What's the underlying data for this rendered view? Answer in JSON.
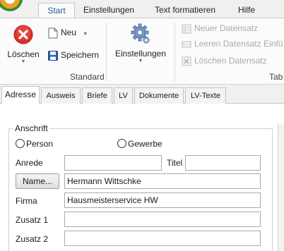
{
  "ribbon": {
    "tabs": [
      {
        "label": "Start",
        "active": true
      },
      {
        "label": "Einstellungen",
        "active": false
      },
      {
        "label": "Text formatieren",
        "active": false
      },
      {
        "label": "Hilfe",
        "active": false
      }
    ],
    "standard_group": {
      "label": "Standard",
      "delete_label": "Löschen",
      "new_label": "Neu",
      "save_label": "Speichern",
      "settings_label": "Einstellungen"
    },
    "tab_group": {
      "label": "Tab",
      "new_record": "Neuer Datensatz",
      "insert_empty_record": "Leeren Datensatz Einfü",
      "delete_record": "Löschen Datensatz"
    }
  },
  "doc_tabs": [
    {
      "label": "Adresse",
      "active": true
    },
    {
      "label": "Ausweis",
      "active": false
    },
    {
      "label": "Briefe",
      "active": false
    },
    {
      "label": "LV",
      "active": false
    },
    {
      "label": "Dokumente",
      "active": false
    },
    {
      "label": "LV-Texte",
      "active": false
    }
  ],
  "form": {
    "section_title": "Anschrift",
    "type_options": {
      "person": "Person",
      "business": "Gewerbe"
    },
    "anrede_label": "Anrede",
    "anrede_value": "",
    "titel_label": "Titel",
    "titel_value": "",
    "name_button": "Name...",
    "name_value": "Hermann Wittschke",
    "firma_label": "Firma",
    "firma_value": "Hausmeisterservice HW",
    "zusatz1_label": "Zusatz 1",
    "zusatz1_value": "",
    "zusatz2_label": "Zusatz 2",
    "zusatz2_value": ""
  },
  "colors": {
    "accent": "#2b579a",
    "delete_red": "#d9312b",
    "ribbon_bg": "#fbfbfb",
    "disabled_text": "#a9a9a9"
  },
  "icons": [
    "app-orb-icon",
    "delete-icon",
    "new-document-icon",
    "save-icon",
    "settings-gear-icon",
    "new-record-icon",
    "insert-empty-record-icon",
    "delete-record-icon"
  ]
}
